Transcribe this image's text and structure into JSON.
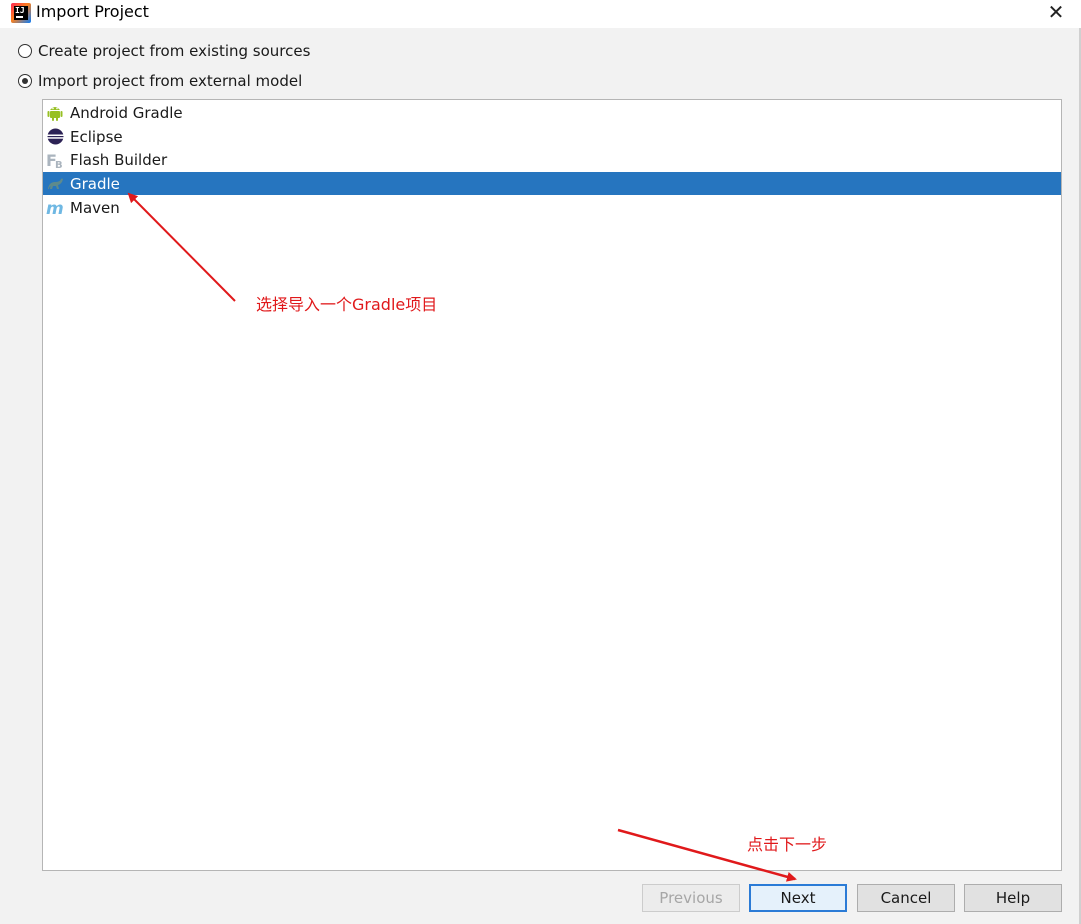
{
  "window": {
    "title": "Import Project",
    "close_label": "✕"
  },
  "options": [
    {
      "label": "Create project from existing sources",
      "checked": false
    },
    {
      "label": "Import project from external model",
      "checked": true
    }
  ],
  "models": [
    {
      "label": "Android Gradle",
      "icon": "android-icon",
      "selected": false
    },
    {
      "label": "Eclipse",
      "icon": "eclipse-icon",
      "selected": false
    },
    {
      "label": "Flash Builder",
      "icon": "flash-builder-icon",
      "selected": false
    },
    {
      "label": "Gradle",
      "icon": "gradle-icon",
      "selected": true
    },
    {
      "label": "Maven",
      "icon": "maven-icon",
      "selected": false
    }
  ],
  "annotations": {
    "select_gradle": "选择导入一个Gradle项目",
    "click_next": "点击下一步"
  },
  "buttons": {
    "previous": "Previous",
    "next": "Next",
    "cancel": "Cancel",
    "help": "Help"
  },
  "colors": {
    "selection": "#2675bf",
    "annotation": "#e0191b"
  }
}
